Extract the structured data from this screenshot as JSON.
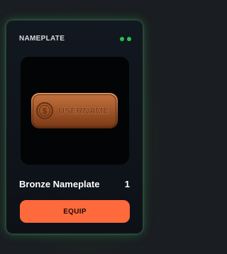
{
  "card": {
    "title": "NAMEPLATE",
    "status_indicator_color": "#27c24c",
    "accent_color": "#ff6a3d"
  },
  "item": {
    "name": "Bronze Nameplate",
    "count": "1",
    "preview_icon": "dollar-coin-icon",
    "preview_text": "USERNAME"
  },
  "actions": {
    "equip_label": "EQUIP"
  }
}
